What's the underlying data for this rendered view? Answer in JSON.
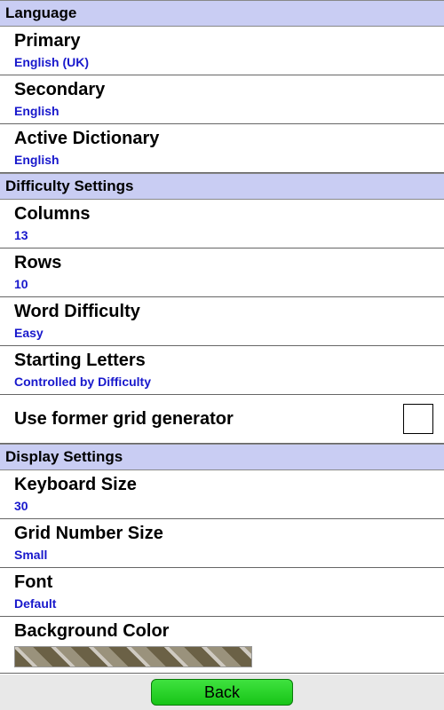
{
  "sections": {
    "language": {
      "header": "Language",
      "primary": {
        "label": "Primary",
        "value": "English (UK)"
      },
      "secondary": {
        "label": "Secondary",
        "value": "English"
      },
      "active_dictionary": {
        "label": "Active Dictionary",
        "value": "English"
      }
    },
    "difficulty": {
      "header": "Difficulty Settings",
      "columns": {
        "label": "Columns",
        "value": "13"
      },
      "rows": {
        "label": "Rows",
        "value": "10"
      },
      "word_difficulty": {
        "label": "Word Difficulty",
        "value": "Easy"
      },
      "starting_letters": {
        "label": "Starting Letters",
        "value": "Controlled by Difficulty"
      },
      "former_grid": {
        "label": "Use former grid generator",
        "checked": false
      }
    },
    "display": {
      "header": "Display Settings",
      "keyboard_size": {
        "label": "Keyboard Size",
        "value": "30"
      },
      "grid_number_size": {
        "label": "Grid Number Size",
        "value": "Small"
      },
      "font": {
        "label": "Font",
        "value": "Default"
      },
      "background_color": {
        "label": "Background Color"
      }
    }
  },
  "footer": {
    "back_label": "Back"
  }
}
